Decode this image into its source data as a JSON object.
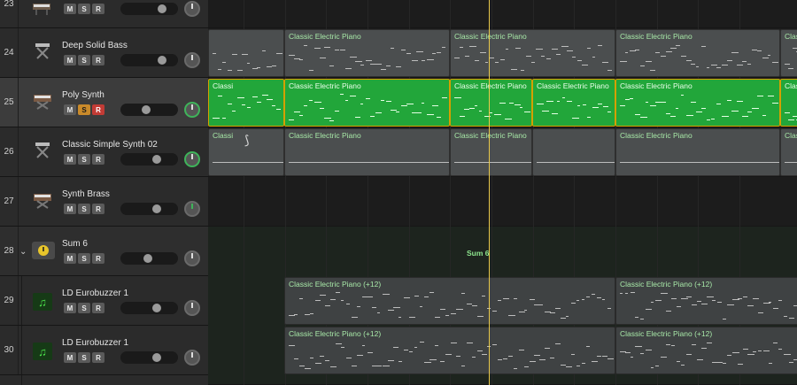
{
  "tracks": [
    {
      "num": "23",
      "name": "",
      "icon": "synth-keyboard-icon",
      "mute": "M",
      "solo": "S",
      "rec": "R"
    },
    {
      "num": "24",
      "name": "Deep Solid Bass",
      "icon": "x-stand-keyboard-icon",
      "mute": "M",
      "solo": "S",
      "rec": "R"
    },
    {
      "num": "25",
      "name": "Poly Synth",
      "icon": "synth-keyboard-icon",
      "mute": "M",
      "solo": "S",
      "rec": "R"
    },
    {
      "num": "26",
      "name": "Classic Simple Synth 02",
      "icon": "x-stand-keyboard-icon",
      "mute": "M",
      "solo": "S",
      "rec": "R"
    },
    {
      "num": "27",
      "name": "Synth Brass",
      "icon": "synth-keyboard-icon",
      "mute": "M",
      "solo": "S",
      "rec": "R"
    },
    {
      "num": "28",
      "name": "Sum 6",
      "icon": "summing-stack-icon",
      "mute": "M",
      "solo": "S",
      "rec": "R"
    },
    {
      "num": "29",
      "name": "LD Eurobuzzer 1",
      "icon": "music-note-icon",
      "mute": "M",
      "solo": "S",
      "rec": "R"
    },
    {
      "num": "30",
      "name": "LD Eurobuzzer 1",
      "icon": "music-note-icon",
      "mute": "M",
      "solo": "S",
      "rec": "R"
    }
  ],
  "regions": {
    "short": "Classi",
    "main": "Classic Electric Piano",
    "octave": "Classic Electric Piano (+12)",
    "sum": "Sum 6"
  },
  "colors": {
    "selected_region": "#22a63a",
    "region_border_selected": "#d4a000",
    "region_label": "#a8e9a8",
    "playhead": "#e8c84a"
  }
}
